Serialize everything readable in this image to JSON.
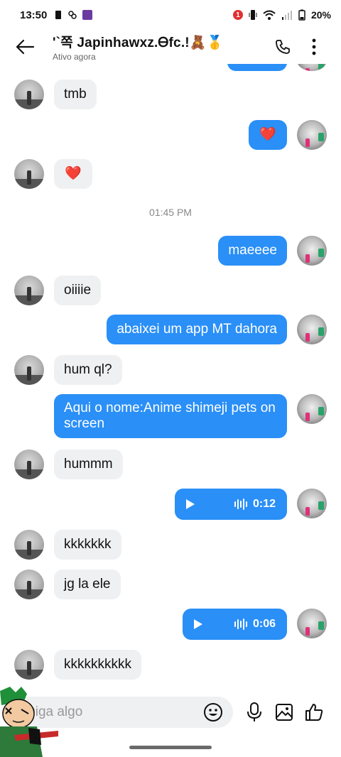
{
  "status_bar": {
    "time": "13:50",
    "notification_count": "1",
    "battery": "20%"
  },
  "header": {
    "title": "'`쪽 Japinhawxz.Ꮎfc.!🧸🥇",
    "subtitle": "Ativo agora"
  },
  "messages": [
    {
      "from": "them",
      "text": "tmb"
    },
    {
      "from": "me",
      "text": "❤️"
    },
    {
      "from": "them",
      "text": "❤️"
    },
    {
      "type": "time",
      "text": "01:45 PM"
    },
    {
      "from": "me",
      "text": "maeeee"
    },
    {
      "from": "them",
      "text": "oiiiie"
    },
    {
      "from": "me",
      "text": "abaixei um app MT dahora"
    },
    {
      "from": "them",
      "text": "hum ql?"
    },
    {
      "from": "me",
      "text": "Aqui o nome:Anime shimeji pets on screen"
    },
    {
      "from": "them",
      "text": "hummm"
    },
    {
      "from": "me",
      "type": "audio",
      "duration": "0:12"
    },
    {
      "from": "them",
      "text": "kkkkkkk"
    },
    {
      "from": "them",
      "text": "jg la ele"
    },
    {
      "from": "me",
      "type": "audio",
      "duration": "0:06"
    },
    {
      "from": "them",
      "text": "kkkkkkkkkk"
    }
  ],
  "composer": {
    "placeholder": "Diga algo"
  },
  "icons": {
    "back": "arrow-left-icon",
    "call": "phone-icon",
    "more": "more-vertical-icon",
    "emoji": "smiley-icon",
    "mic": "microphone-icon",
    "image": "image-icon",
    "like": "thumbs-up-icon"
  },
  "colors": {
    "outgoing_bubble": "#2a8ff7",
    "incoming_bubble": "#eff0f2"
  }
}
